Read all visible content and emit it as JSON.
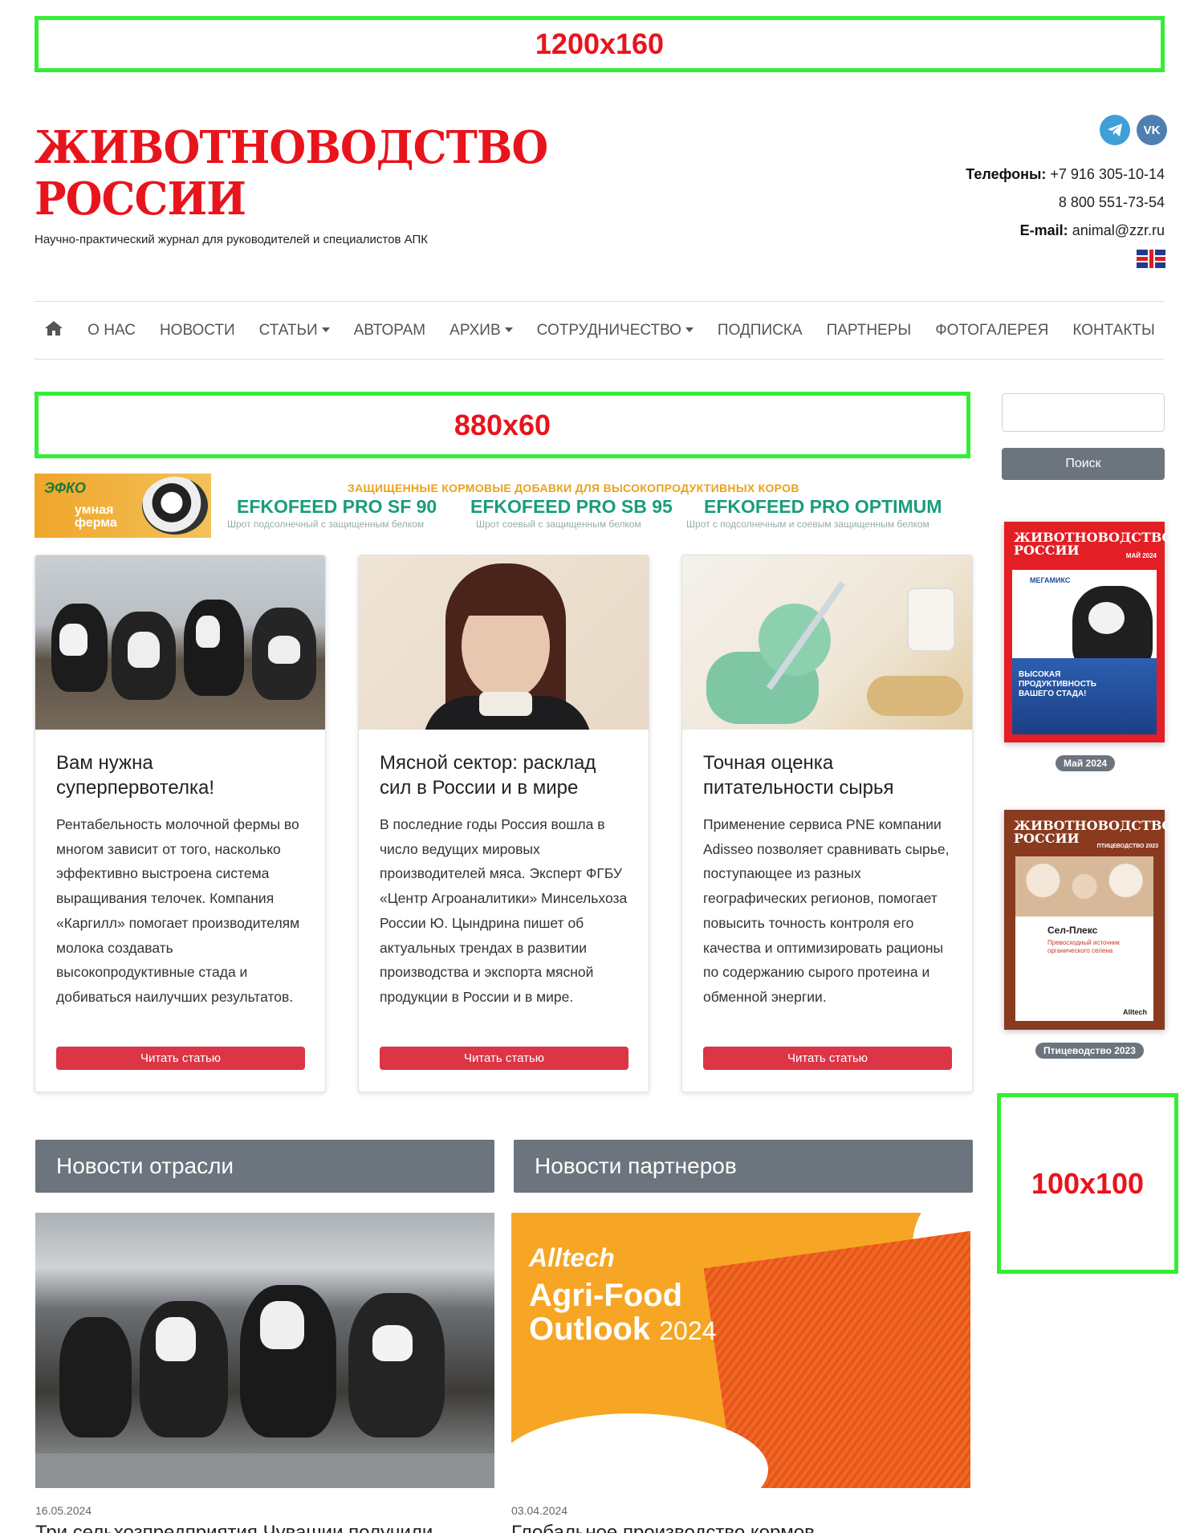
{
  "ads": {
    "top": "1200x160",
    "middle": "880x60",
    "side": "100x100"
  },
  "header": {
    "logo_line1": "ЖИВОТНОВОДСТВО",
    "logo_line2": "РОССИИ",
    "tagline": "Научно-практический журнал для руководителей и специалистов АПК",
    "social": [
      {
        "name": "telegram",
        "icon": "telegram-icon"
      },
      {
        "name": "vk",
        "icon": "vk-icon"
      }
    ],
    "phones_label": "Телефоны:",
    "phone1": "+7 916 305-10-14",
    "phone2": "8 800 551-73-54",
    "email_label": "E-mail:",
    "email": "animal@zzr.ru",
    "language_icon": "uk-flag-icon"
  },
  "nav": {
    "home_icon": "home-icon",
    "items": [
      {
        "label": "О НАС",
        "dropdown": false
      },
      {
        "label": "НОВОСТИ",
        "dropdown": false
      },
      {
        "label": "СТАТЬИ",
        "dropdown": true
      },
      {
        "label": "АВТОРАМ",
        "dropdown": false
      },
      {
        "label": "АРХИВ",
        "dropdown": true
      },
      {
        "label": "СОТРУДНИЧЕСТВО",
        "dropdown": true
      },
      {
        "label": "ПОДПИСКА",
        "dropdown": false
      },
      {
        "label": "ПАРТНЕРЫ",
        "dropdown": false
      },
      {
        "label": "ФОТОГАЛЕРЕЯ",
        "dropdown": false
      },
      {
        "label": "КОНТАКТЫ",
        "dropdown": false
      }
    ]
  },
  "search": {
    "placeholder": "",
    "button": "Поиск"
  },
  "banner": {
    "brand1": "ЭФКО",
    "brand2_line1": "умная",
    "brand2_line2": "ферма",
    "title": "ЗАЩИЩЕННЫЕ КОРМОВЫЕ ДОБАВКИ ДЛЯ ВЫСОКОПРОДУКТИВНЫХ КОРОВ",
    "products": [
      {
        "name": "EFKOFEED PRO SF 90",
        "sub": "Шрот подсолнечный с защищенным белком"
      },
      {
        "name": "EFKOFEED PRO SB 95",
        "sub": "Шрот соевый с защищенным белком"
      },
      {
        "name": "EFKOFEED PRO OPTIMUM",
        "sub": "Шрот с подсолнечным и соевым защищенным белком"
      }
    ]
  },
  "articles": [
    {
      "title": "Вам нужна суперпервотелка!",
      "text": "Рентабельность молочной фермы во многом зависит от того, насколько эффективно выстроена система выращивания телочек. Компания «Каргилл» помогает производителям молока создавать высокопродуктивные стада и добиваться наилучших результатов.",
      "button": "Читать статью"
    },
    {
      "title": "Мясной сектор: расклад сил в России и в мире",
      "text": "В последние годы Россия вошла в число ведущих мировых производителей мяса. Эксперт ФГБУ «Центр Агроаналитики» Минсельхоза России Ю. Цындрина пишет об актуальных трендах в развитии производства и экспорта мясной продукции в России и в мире.",
      "button": "Читать статью"
    },
    {
      "title": "Точная оценка питательности сырья",
      "text": "Применение сервиса PNE компании Adisseo позволяет сравнивать сырье, поступающее из разных географических регионов, помогает повысить точность контроля его качества и оптимизировать рационы по содержанию сырого протеина и обменной энергии.",
      "button": "Читать статью"
    }
  ],
  "sidebar": {
    "magazines": [
      {
        "title_line1": "ЖИВОТНОВОДСТВО",
        "title_line2": "РОССИИ",
        "issue": "МАЙ 2024",
        "sponsor": "МЕГАМИКС",
        "headline": "ВЫСОКАЯ ПРОДУКТИВНОСТЬ ВАШЕГО СТАДА!",
        "badge": "Май 2024"
      },
      {
        "title_line1": "ЖИВОТНОВОДСТВО",
        "title_line2": "РОССИИ",
        "issue": "ПТИЦЕВОДСТВО 2023",
        "product": "Сел-Плекс",
        "headline": "Превосходный источник органического селена",
        "brand": "Alltech",
        "badge": "Птицеводство 2023"
      }
    ]
  },
  "news": {
    "industry": {
      "header": "Новости отрасли",
      "date": "16.05.2024",
      "title": "Три сельхозпредприятия Чувашии получили"
    },
    "partners": {
      "header": "Новости партнеров",
      "date": "03.04.2024",
      "title": "Глобальное производство кормов",
      "image_brand": "Alltech",
      "image_line1": "Agri-Food",
      "image_line2": "Outlook",
      "image_year": "2024"
    }
  }
}
